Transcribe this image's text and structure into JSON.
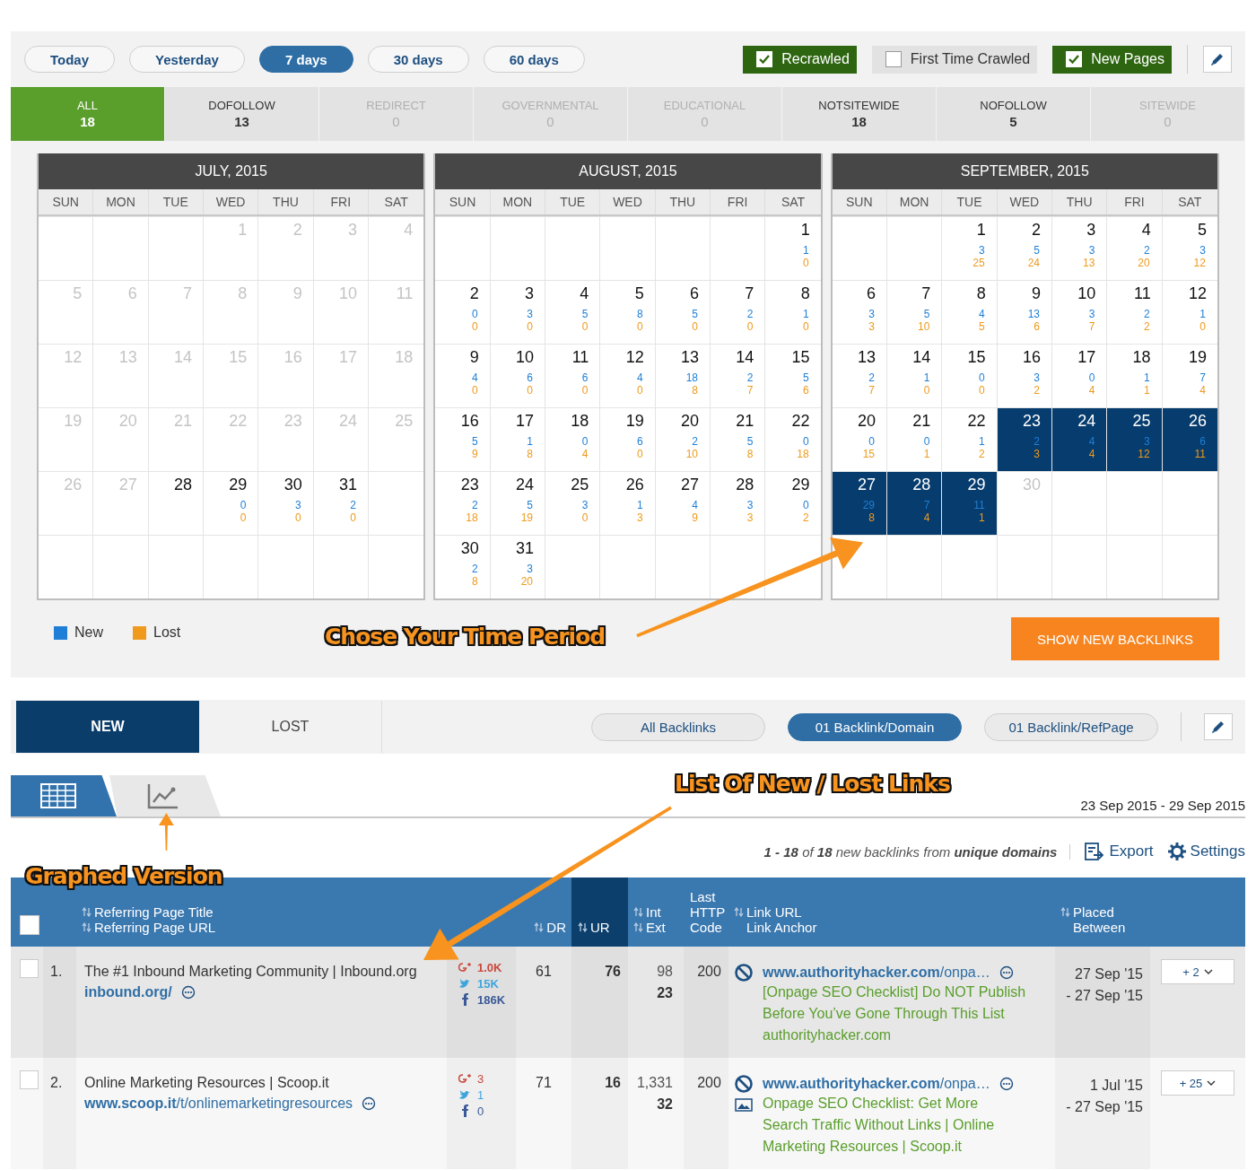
{
  "periods": [
    {
      "label": "Today",
      "selected": false
    },
    {
      "label": "Yesterday",
      "selected": false
    },
    {
      "label": "7 days",
      "selected": true
    },
    {
      "label": "30 days",
      "selected": false
    },
    {
      "label": "60 days",
      "selected": false
    }
  ],
  "crawl_filters": [
    {
      "label": "Recrawled",
      "checked": true
    },
    {
      "label": "First Time Crawled",
      "checked": false
    },
    {
      "label": "New Pages",
      "checked": true
    }
  ],
  "link_types": [
    {
      "label": "ALL",
      "count": "18",
      "selected": true,
      "disabled": false
    },
    {
      "label": "DOFOLLOW",
      "count": "13",
      "selected": false,
      "disabled": false
    },
    {
      "label": "REDIRECT",
      "count": "0",
      "selected": false,
      "disabled": true
    },
    {
      "label": "GOVERNMENTAL",
      "count": "0",
      "selected": false,
      "disabled": true
    },
    {
      "label": "EDUCATIONAL",
      "count": "0",
      "selected": false,
      "disabled": true
    },
    {
      "label": "NOTSITEWIDE",
      "count": "18",
      "selected": false,
      "disabled": false
    },
    {
      "label": "NOFOLLOW",
      "count": "5",
      "selected": false,
      "disabled": false
    },
    {
      "label": "SITEWIDE",
      "count": "0",
      "selected": false,
      "disabled": true
    }
  ],
  "calendars": [
    {
      "title": "JULY, 2015",
      "weekdays": [
        "SUN",
        "MON",
        "TUE",
        "WED",
        "THU",
        "FRI",
        "SAT"
      ],
      "weeks": [
        [
          {
            "kind": "empty"
          },
          {
            "kind": "empty"
          },
          {
            "kind": "empty"
          },
          {
            "kind": "inactive",
            "day": "1"
          },
          {
            "kind": "inactive",
            "day": "2"
          },
          {
            "kind": "inactive",
            "day": "3"
          },
          {
            "kind": "inactive",
            "day": "4"
          }
        ],
        [
          {
            "kind": "inactive",
            "day": "5"
          },
          {
            "kind": "inactive",
            "day": "6"
          },
          {
            "kind": "inactive",
            "day": "7"
          },
          {
            "kind": "inactive",
            "day": "8"
          },
          {
            "kind": "inactive",
            "day": "9"
          },
          {
            "kind": "inactive",
            "day": "10"
          },
          {
            "kind": "inactive",
            "day": "11"
          }
        ],
        [
          {
            "kind": "inactive",
            "day": "12"
          },
          {
            "kind": "inactive",
            "day": "13"
          },
          {
            "kind": "inactive",
            "day": "14"
          },
          {
            "kind": "inactive",
            "day": "15"
          },
          {
            "kind": "inactive",
            "day": "16"
          },
          {
            "kind": "inactive",
            "day": "17"
          },
          {
            "kind": "inactive",
            "day": "18"
          }
        ],
        [
          {
            "kind": "inactive",
            "day": "19"
          },
          {
            "kind": "inactive",
            "day": "20"
          },
          {
            "kind": "inactive",
            "day": "21"
          },
          {
            "kind": "inactive",
            "day": "22"
          },
          {
            "kind": "inactive",
            "day": "23"
          },
          {
            "kind": "inactive",
            "day": "24"
          },
          {
            "kind": "inactive",
            "day": "25"
          }
        ],
        [
          {
            "kind": "inactive",
            "day": "26"
          },
          {
            "kind": "inactive",
            "day": "27"
          },
          {
            "kind": "active",
            "day": "28",
            "selected": false
          },
          {
            "kind": "active",
            "day": "29",
            "new": "0",
            "lost": "0",
            "selected": false
          },
          {
            "kind": "active",
            "day": "30",
            "new": "3",
            "lost": "0",
            "selected": false
          },
          {
            "kind": "active",
            "day": "31",
            "new": "2",
            "lost": "0",
            "selected": false
          },
          {
            "kind": "empty"
          }
        ],
        [
          {
            "kind": "empty"
          },
          {
            "kind": "empty"
          },
          {
            "kind": "empty"
          },
          {
            "kind": "empty"
          },
          {
            "kind": "empty"
          },
          {
            "kind": "empty"
          },
          {
            "kind": "empty"
          }
        ]
      ]
    },
    {
      "title": "AUGUST, 2015",
      "weekdays": [
        "SUN",
        "MON",
        "TUE",
        "WED",
        "THU",
        "FRI",
        "SAT"
      ],
      "weeks": [
        [
          {
            "kind": "empty"
          },
          {
            "kind": "empty"
          },
          {
            "kind": "empty"
          },
          {
            "kind": "empty"
          },
          {
            "kind": "empty"
          },
          {
            "kind": "empty"
          },
          {
            "kind": "active",
            "day": "1",
            "new": "1",
            "lost": "0",
            "selected": false
          }
        ],
        [
          {
            "kind": "active",
            "day": "2",
            "new": "0",
            "lost": "0",
            "selected": false
          },
          {
            "kind": "active",
            "day": "3",
            "new": "3",
            "lost": "0",
            "selected": false
          },
          {
            "kind": "active",
            "day": "4",
            "new": "5",
            "lost": "0",
            "selected": false
          },
          {
            "kind": "active",
            "day": "5",
            "new": "8",
            "lost": "0",
            "selected": false
          },
          {
            "kind": "active",
            "day": "6",
            "new": "5",
            "lost": "0",
            "selected": false
          },
          {
            "kind": "active",
            "day": "7",
            "new": "2",
            "lost": "0",
            "selected": false
          },
          {
            "kind": "active",
            "day": "8",
            "new": "1",
            "lost": "0",
            "selected": false
          }
        ],
        [
          {
            "kind": "active",
            "day": "9",
            "new": "4",
            "lost": "0",
            "selected": false
          },
          {
            "kind": "active",
            "day": "10",
            "new": "6",
            "lost": "0",
            "selected": false
          },
          {
            "kind": "active",
            "day": "11",
            "new": "6",
            "lost": "0",
            "selected": false
          },
          {
            "kind": "active",
            "day": "12",
            "new": "4",
            "lost": "0",
            "selected": false
          },
          {
            "kind": "active",
            "day": "13",
            "new": "18",
            "lost": "8",
            "selected": false
          },
          {
            "kind": "active",
            "day": "14",
            "new": "2",
            "lost": "7",
            "selected": false
          },
          {
            "kind": "active",
            "day": "15",
            "new": "5",
            "lost": "6",
            "selected": false
          }
        ],
        [
          {
            "kind": "active",
            "day": "16",
            "new": "5",
            "lost": "9",
            "selected": false
          },
          {
            "kind": "active",
            "day": "17",
            "new": "1",
            "lost": "8",
            "selected": false
          },
          {
            "kind": "active",
            "day": "18",
            "new": "0",
            "lost": "4",
            "selected": false
          },
          {
            "kind": "active",
            "day": "19",
            "new": "6",
            "lost": "0",
            "selected": false
          },
          {
            "kind": "active",
            "day": "20",
            "new": "2",
            "lost": "10",
            "selected": false
          },
          {
            "kind": "active",
            "day": "21",
            "new": "5",
            "lost": "8",
            "selected": false
          },
          {
            "kind": "active",
            "day": "22",
            "new": "0",
            "lost": "18",
            "selected": false
          }
        ],
        [
          {
            "kind": "active",
            "day": "23",
            "new": "2",
            "lost": "18",
            "selected": false
          },
          {
            "kind": "active",
            "day": "24",
            "new": "5",
            "lost": "19",
            "selected": false
          },
          {
            "kind": "active",
            "day": "25",
            "new": "3",
            "lost": "0",
            "selected": false
          },
          {
            "kind": "active",
            "day": "26",
            "new": "1",
            "lost": "3",
            "selected": false
          },
          {
            "kind": "active",
            "day": "27",
            "new": "4",
            "lost": "9",
            "selected": false
          },
          {
            "kind": "active",
            "day": "28",
            "new": "3",
            "lost": "3",
            "selected": false
          },
          {
            "kind": "active",
            "day": "29",
            "new": "0",
            "lost": "2",
            "selected": false
          }
        ],
        [
          {
            "kind": "active",
            "day": "30",
            "new": "2",
            "lost": "8",
            "selected": false
          },
          {
            "kind": "active",
            "day": "31",
            "new": "3",
            "lost": "20",
            "selected": false
          },
          {
            "kind": "empty"
          },
          {
            "kind": "empty"
          },
          {
            "kind": "empty"
          },
          {
            "kind": "empty"
          },
          {
            "kind": "empty"
          }
        ]
      ]
    },
    {
      "title": "SEPTEMBER, 2015",
      "weekdays": [
        "SUN",
        "MON",
        "TUE",
        "WED",
        "THU",
        "FRI",
        "SAT"
      ],
      "weeks": [
        [
          {
            "kind": "empty"
          },
          {
            "kind": "empty"
          },
          {
            "kind": "active",
            "day": "1",
            "new": "3",
            "lost": "25",
            "selected": false
          },
          {
            "kind": "active",
            "day": "2",
            "new": "5",
            "lost": "24",
            "selected": false
          },
          {
            "kind": "active",
            "day": "3",
            "new": "3",
            "lost": "13",
            "selected": false
          },
          {
            "kind": "active",
            "day": "4",
            "new": "2",
            "lost": "20",
            "selected": false
          },
          {
            "kind": "active",
            "day": "5",
            "new": "3",
            "lost": "12",
            "selected": false
          }
        ],
        [
          {
            "kind": "active",
            "day": "6",
            "new": "3",
            "lost": "3",
            "selected": false
          },
          {
            "kind": "active",
            "day": "7",
            "new": "5",
            "lost": "10",
            "selected": false
          },
          {
            "kind": "active",
            "day": "8",
            "new": "4",
            "lost": "5",
            "selected": false
          },
          {
            "kind": "active",
            "day": "9",
            "new": "13",
            "lost": "6",
            "selected": false
          },
          {
            "kind": "active",
            "day": "10",
            "new": "3",
            "lost": "7",
            "selected": false
          },
          {
            "kind": "active",
            "day": "11",
            "new": "2",
            "lost": "2",
            "selected": false
          },
          {
            "kind": "active",
            "day": "12",
            "new": "1",
            "lost": "0",
            "selected": false
          }
        ],
        [
          {
            "kind": "active",
            "day": "13",
            "new": "2",
            "lost": "7",
            "selected": false
          },
          {
            "kind": "active",
            "day": "14",
            "new": "1",
            "lost": "0",
            "selected": false
          },
          {
            "kind": "active",
            "day": "15",
            "new": "0",
            "lost": "0",
            "selected": false
          },
          {
            "kind": "active",
            "day": "16",
            "new": "3",
            "lost": "2",
            "selected": false
          },
          {
            "kind": "active",
            "day": "17",
            "new": "0",
            "lost": "4",
            "selected": false
          },
          {
            "kind": "active",
            "day": "18",
            "new": "1",
            "lost": "1",
            "selected": false
          },
          {
            "kind": "active",
            "day": "19",
            "new": "7",
            "lost": "4",
            "selected": false
          }
        ],
        [
          {
            "kind": "active",
            "day": "20",
            "new": "0",
            "lost": "15",
            "selected": false
          },
          {
            "kind": "active",
            "day": "21",
            "new": "0",
            "lost": "1",
            "selected": false
          },
          {
            "kind": "active",
            "day": "22",
            "new": "1",
            "lost": "2",
            "selected": false
          },
          {
            "kind": "active",
            "day": "23",
            "new": "2",
            "lost": "3",
            "selected": true
          },
          {
            "kind": "active",
            "day": "24",
            "new": "4",
            "lost": "4",
            "selected": true
          },
          {
            "kind": "active",
            "day": "25",
            "new": "3",
            "lost": "12",
            "selected": true
          },
          {
            "kind": "active",
            "day": "26",
            "new": "6",
            "lost": "11",
            "selected": true
          }
        ],
        [
          {
            "kind": "active",
            "day": "27",
            "new": "29",
            "lost": "8",
            "selected": true
          },
          {
            "kind": "active",
            "day": "28",
            "new": "7",
            "lost": "4",
            "selected": true
          },
          {
            "kind": "active",
            "day": "29",
            "new": "11",
            "lost": "1",
            "selected": true
          },
          {
            "kind": "inactive",
            "day": "30"
          },
          {
            "kind": "empty"
          },
          {
            "kind": "empty"
          },
          {
            "kind": "empty"
          }
        ],
        [
          {
            "kind": "empty"
          },
          {
            "kind": "empty"
          },
          {
            "kind": "empty"
          },
          {
            "kind": "empty"
          },
          {
            "kind": "empty"
          },
          {
            "kind": "empty"
          },
          {
            "kind": "empty"
          }
        ]
      ]
    }
  ],
  "legend": [
    {
      "label": "New",
      "color": "#1f7fd6"
    },
    {
      "label": "Lost",
      "color": "#ef9a1c"
    }
  ],
  "show_button": "SHOW NEW BACKLINKS",
  "result_tabs": [
    {
      "label": "NEW",
      "selected": true
    },
    {
      "label": "LOST",
      "selected": false
    }
  ],
  "grouping": [
    {
      "label": "All Backlinks",
      "selected": false
    },
    {
      "label": "01 Backlink/Domain",
      "selected": true
    },
    {
      "label": "01 Backlink/RefPage",
      "selected": false
    }
  ],
  "views": [
    {
      "kind": "table",
      "selected": true
    },
    {
      "kind": "chart",
      "selected": false
    }
  ],
  "date_range": "23 Sep 2015 - 29 Sep 2015",
  "summary": "**1 - 18** of **18** new backlinks from **unique domains**",
  "actions": [
    {
      "kind": "export",
      "label": "Export"
    },
    {
      "kind": "settings",
      "label": "Settings"
    }
  ],
  "table": {
    "select_all": {
      "checked": false
    },
    "columns": [
      {
        "lines": [
          {
            "text": "Referring Page Title",
            "sortable": true
          },
          {
            "text": "Referring Page URL",
            "sortable": true
          }
        ],
        "sorted": false
      },
      {
        "lines": [
          {
            "text": "DR",
            "sortable": true
          }
        ],
        "sorted": false
      },
      {
        "lines": [
          {
            "text": "UR",
            "sortable": true
          }
        ],
        "sorted": true
      },
      {
        "lines": [
          {
            "text": "Int",
            "sortable": true
          },
          {
            "text": "Ext",
            "sortable": true
          }
        ],
        "sorted": false
      },
      {
        "lines": [
          {
            "text": "Last",
            "sortable": false
          },
          {
            "text": "HTTP",
            "sortable": false
          },
          {
            "text": "Code",
            "sortable": false
          }
        ],
        "sorted": false
      },
      {
        "lines": [
          {
            "text": "Link URL",
            "sortable": true
          },
          {
            "text": "Link Anchor",
            "sortable": false
          }
        ],
        "sorted": false
      },
      {
        "lines": [
          {
            "text": "Placed",
            "sortable": true
          },
          {
            "text": "Between",
            "sortable": false
          }
        ],
        "sorted": false
      }
    ],
    "rows": [
      {
        "number": "1.",
        "checked": false,
        "highlighted": true,
        "title": "The #1 Inbound Marketing Community | Inbound.org",
        "url": "**inbound.org/**",
        "social": [
          {
            "kind": "google_plus",
            "value": "1.0K"
          },
          {
            "kind": "twitter",
            "value": "15K"
          },
          {
            "kind": "facebook",
            "value": "186K"
          }
        ],
        "social_bold": true,
        "dr": "61",
        "ur": "76",
        "int": "98",
        "ext": "23",
        "http": "200",
        "link_url": "**www.authorityhacker.com**/onpa…",
        "nofollow": true,
        "image": false,
        "anchor": "[Onpage SEO Checklist] Do NOT Publish Before You’ve Gone Through This List authorityhacker.com",
        "placed_from": "27 Sep '15",
        "placed_to": "- 27 Sep '15",
        "more": "+ 2"
      },
      {
        "number": "2.",
        "checked": false,
        "highlighted": false,
        "title": "Online Marketing Resources | Scoop.it",
        "url": "**www.scoop.it**/t/onlinemarketingresources",
        "social": [
          {
            "kind": "google_plus",
            "value": "3"
          },
          {
            "kind": "twitter",
            "value": "1"
          },
          {
            "kind": "facebook",
            "value": "0"
          }
        ],
        "social_bold": false,
        "dr": "71",
        "ur": "16",
        "int": "1,331",
        "ext": "32",
        "http": "200",
        "link_url": "**www.authorityhacker.com**/onpa…",
        "nofollow": true,
        "image": true,
        "anchor": "Onpage SEO Checklist: Get More Search Traffic Without Links | Online Marketing Resources | Scoop.it",
        "placed_from": "1 Jul '15",
        "placed_to": "- 27 Sep '15",
        "more": "+ 25"
      }
    ]
  },
  "annotations": [
    "Chose Your Time Period",
    "List Of New / Lost Links",
    "Graphed Version"
  ]
}
